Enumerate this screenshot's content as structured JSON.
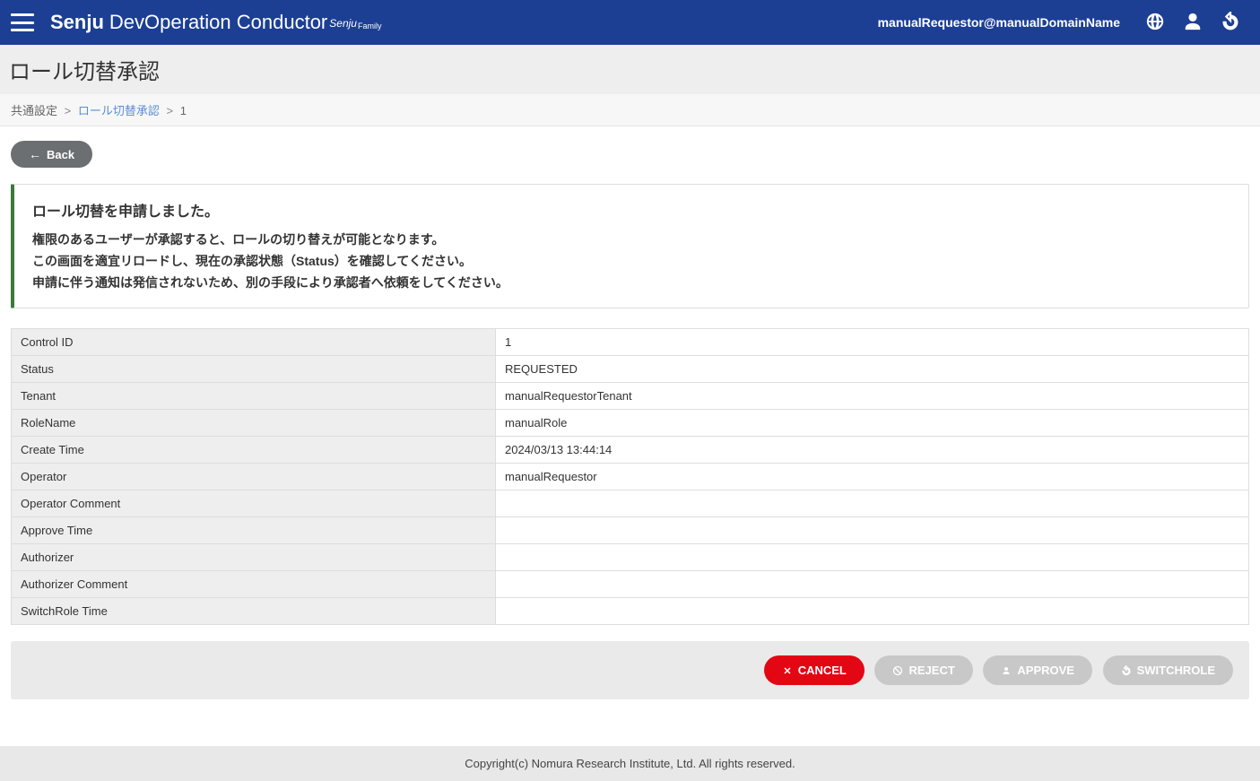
{
  "header": {
    "brand_senju": "Senju",
    "brand_rest": "DevOperation Conductor",
    "brand_small": "Senju",
    "brand_family": "Family",
    "user": "manualRequestor@manualDomainName"
  },
  "page": {
    "title": "ロール切替承認"
  },
  "breadcrumb": {
    "root": "共通設定",
    "link": "ロール切替承認",
    "current": "1"
  },
  "buttons": {
    "back": "Back",
    "cancel": "CANCEL",
    "reject": "REJECT",
    "approve": "APPROVE",
    "switchrole": "SWITCHROLE"
  },
  "notice": {
    "title": "ロール切替を申請しました。",
    "line1": "権限のあるユーザーが承認すると、ロールの切り替えが可能となります。",
    "line2": "この画面を適宜リロードし、現在の承認状態（Status）を確認してください。",
    "line3": "申請に伴う通知は発信されないため、別の手段により承認者へ依頼をしてください。"
  },
  "fields": {
    "control_id": {
      "label": "Control ID",
      "value": "1"
    },
    "status": {
      "label": "Status",
      "value": "REQUESTED"
    },
    "tenant": {
      "label": "Tenant",
      "value": "manualRequestorTenant"
    },
    "role_name": {
      "label": "RoleName",
      "value": "manualRole"
    },
    "create_time": {
      "label": "Create Time",
      "value": "2024/03/13 13:44:14"
    },
    "operator": {
      "label": "Operator",
      "value": "manualRequestor"
    },
    "operator_comment": {
      "label": "Operator Comment",
      "value": ""
    },
    "approve_time": {
      "label": "Approve Time",
      "value": ""
    },
    "authorizer": {
      "label": "Authorizer",
      "value": ""
    },
    "authorizer_comment": {
      "label": "Authorizer Comment",
      "value": ""
    },
    "switchrole_time": {
      "label": "SwitchRole Time",
      "value": ""
    }
  },
  "footer": {
    "copyright": "Copyright(c) Nomura Research Institute, Ltd. All rights reserved."
  }
}
